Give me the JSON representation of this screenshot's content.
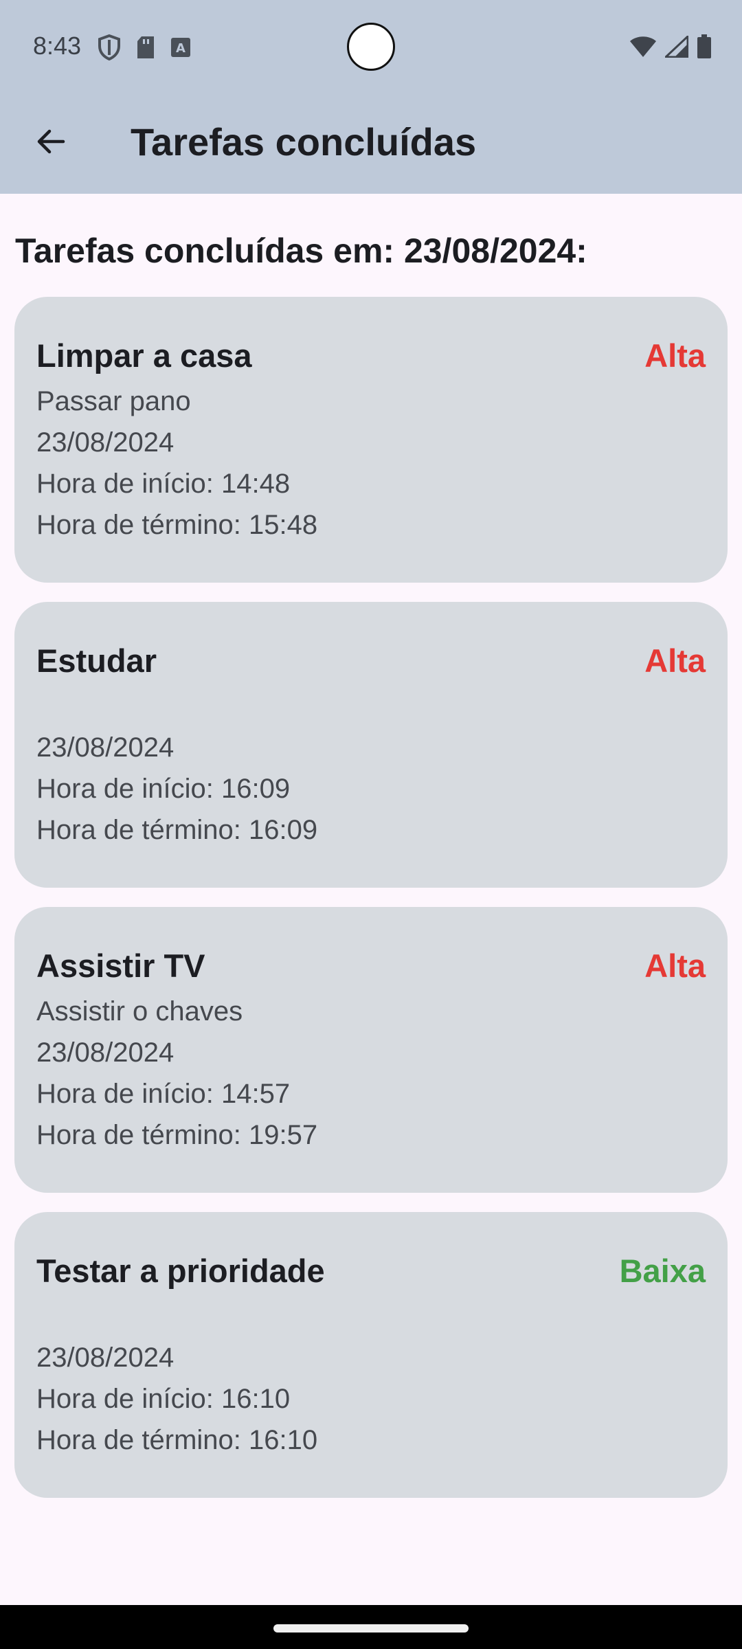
{
  "status_bar": {
    "time": "8:43",
    "icons_left": [
      "shield-icon",
      "sd-card-icon",
      "keyboard-a-icon"
    ],
    "icons_right": [
      "wifi-icon",
      "signal-icon",
      "battery-icon"
    ]
  },
  "app_bar": {
    "title": "Tarefas concluídas",
    "back_icon": "arrow-left-icon"
  },
  "section": {
    "heading": "Tarefas concluídas em: 23/08/2024:"
  },
  "colors": {
    "priority_high": "#e53935",
    "priority_low": "#43a047",
    "app_bar_bg": "#bec9d9",
    "card_bg": "#d7dbe0",
    "page_bg": "#fdf6fd"
  },
  "tasks": [
    {
      "title": "Limpar a casa",
      "priority": "Alta",
      "description": "Passar pano",
      "date": "23/08/2024",
      "start": "Hora de início: 14:48",
      "end": "Hora de término: 15:48"
    },
    {
      "title": "Estudar",
      "priority": "Alta",
      "description": "",
      "date": "23/08/2024",
      "start": "Hora de início: 16:09",
      "end": "Hora de término: 16:09"
    },
    {
      "title": "Assistir TV",
      "priority": "Alta",
      "description": "Assistir o chaves",
      "date": "23/08/2024",
      "start": "Hora de início: 14:57",
      "end": "Hora de término: 19:57"
    },
    {
      "title": "Testar a prioridade",
      "priority": "Baixa",
      "description": "",
      "date": "23/08/2024",
      "start": "Hora de início: 16:10",
      "end": "Hora de término: 16:10"
    }
  ]
}
